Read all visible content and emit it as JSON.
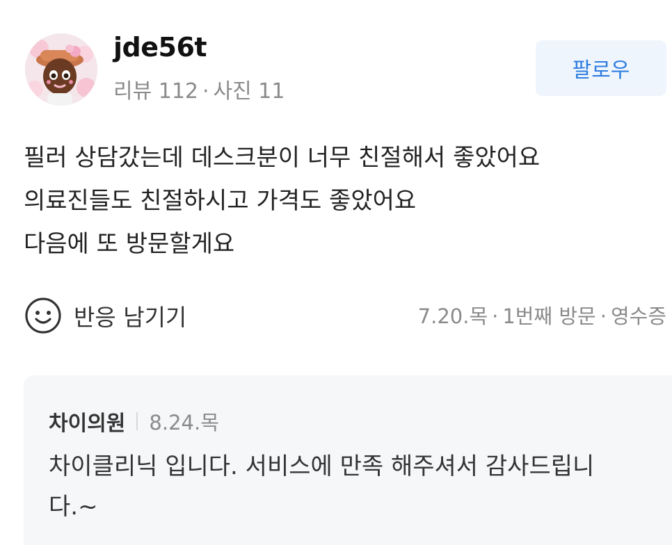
{
  "profile": {
    "username": "jde56t",
    "reviews_label": "리뷰 112",
    "photos_label": "사진 11",
    "separator": "·",
    "avatar_icon": "avatar-icon"
  },
  "follow": {
    "label": "팔로우"
  },
  "review": {
    "lines": [
      "필러 상담갔는데 데스크분이 너무 친절해서 좋았어요",
      "의료진들도 친절하시고 가격도 좋았어요",
      "다음에 또 방문할게요"
    ]
  },
  "reaction": {
    "icon": "smile-icon",
    "label": "반응 남기기"
  },
  "visit": {
    "date": "7.20.목",
    "visit_count": "1번째 방문",
    "receipt": "영수증",
    "separator": "·"
  },
  "reply": {
    "author": "차이의원",
    "date": "8.24.목",
    "text": "차이클리닉 입니다. 서비스에 만족 해주셔서 감사드립니다.~"
  },
  "colors": {
    "accent": "#2f7de1",
    "follow_bg": "#eef5fc",
    "muted_text": "#8a8a8a",
    "reply_bg": "#f5f7f9"
  }
}
